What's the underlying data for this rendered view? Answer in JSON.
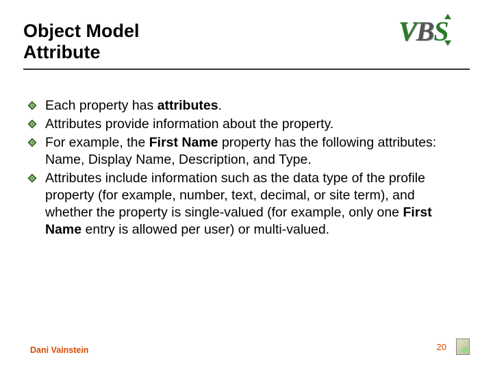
{
  "header": {
    "title_line1": "Object Model",
    "title_line2": "Attribute"
  },
  "logo": {
    "text": "VBS"
  },
  "bullets": [
    {
      "segments": [
        {
          "text": "Each property has ",
          "bold": false
        },
        {
          "text": "attributes",
          "bold": true
        },
        {
          "text": ".",
          "bold": false
        }
      ]
    },
    {
      "segments": [
        {
          "text": "Attributes provide information about the property.",
          "bold": false
        }
      ]
    },
    {
      "segments": [
        {
          "text": "For example, the ",
          "bold": false
        },
        {
          "text": "First Name",
          "bold": true
        },
        {
          "text": " property has the following attributes: Name, Display Name, Description, and Type.",
          "bold": false
        }
      ]
    },
    {
      "segments": [
        {
          "text": "Attributes include information such as the data type of the profile property (for example, number, text, decimal, or site term), and whether the property is single-valued (for example, only one ",
          "bold": false
        },
        {
          "text": "First Name",
          "bold": true
        },
        {
          "text": " entry is allowed per user) or multi-valued.",
          "bold": false
        }
      ]
    }
  ],
  "footer": {
    "author": "Dani Vainstein",
    "page": "20"
  }
}
